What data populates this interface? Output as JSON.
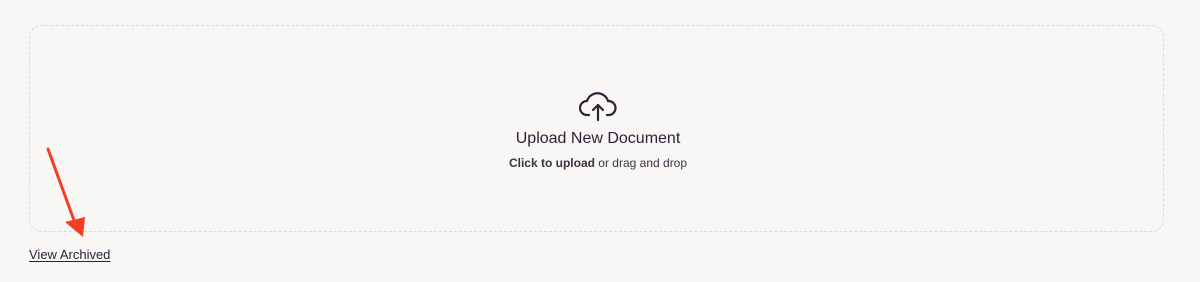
{
  "upload": {
    "title": "Upload New Document",
    "click_text": "Click to upload",
    "drag_text": " or drag and drop",
    "icon": "cloud-upload-icon"
  },
  "links": {
    "view_archived": "View Archived"
  },
  "annotation": {
    "arrow_color": "#f0401f"
  }
}
